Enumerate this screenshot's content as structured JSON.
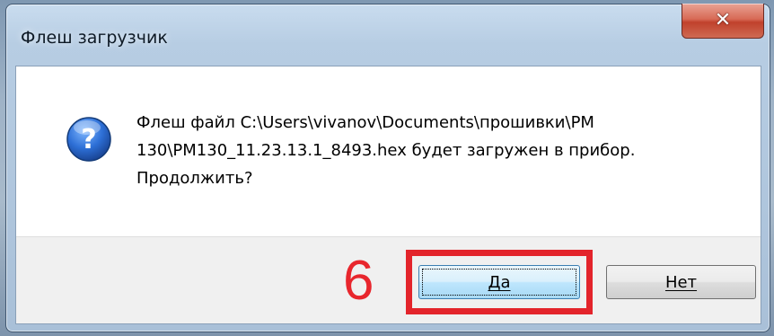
{
  "window": {
    "title": "Флеш загрузчик",
    "close_icon": "close-icon"
  },
  "dialog": {
    "icon": "question-icon",
    "message": "Флеш файл C:\\Users\\vivanov\\Documents\\прошивки\\PM\n130\\PM130_11.23.13.1_8493.hex будет загружен в прибор.\nПродолжить?"
  },
  "annotation": {
    "step_number": "6",
    "color": "#e3242b"
  },
  "buttons": {
    "yes_label": "Да",
    "no_label": "Нет",
    "default": "yes"
  }
}
